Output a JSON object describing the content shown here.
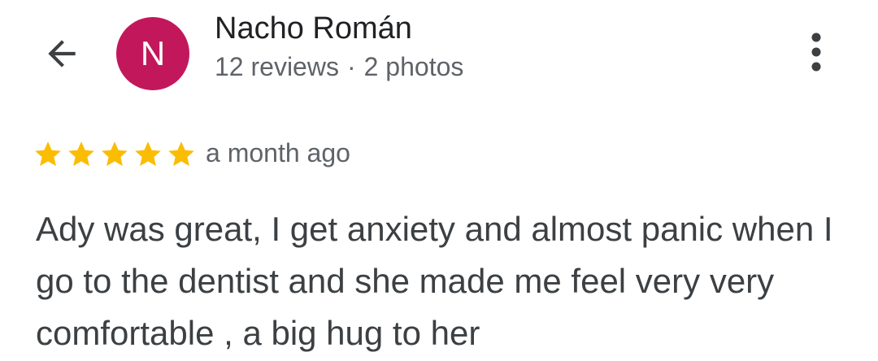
{
  "header": {
    "back_icon": "arrow-back-icon",
    "more_icon": "more-vert-icon"
  },
  "reviewer": {
    "avatar_letter": "N",
    "avatar_color": "#c2185b",
    "name": "Nacho Román",
    "reviews": "12 reviews",
    "separator": "·",
    "photos": "2 photos"
  },
  "review": {
    "rating": 5,
    "max_rating": 5,
    "star_color": "#fbbc04",
    "date": "a month ago",
    "text": "Ady was great, I get anxiety and almost panic when I go to the dentist and she made me feel very very comfortable , a big hug to her"
  }
}
